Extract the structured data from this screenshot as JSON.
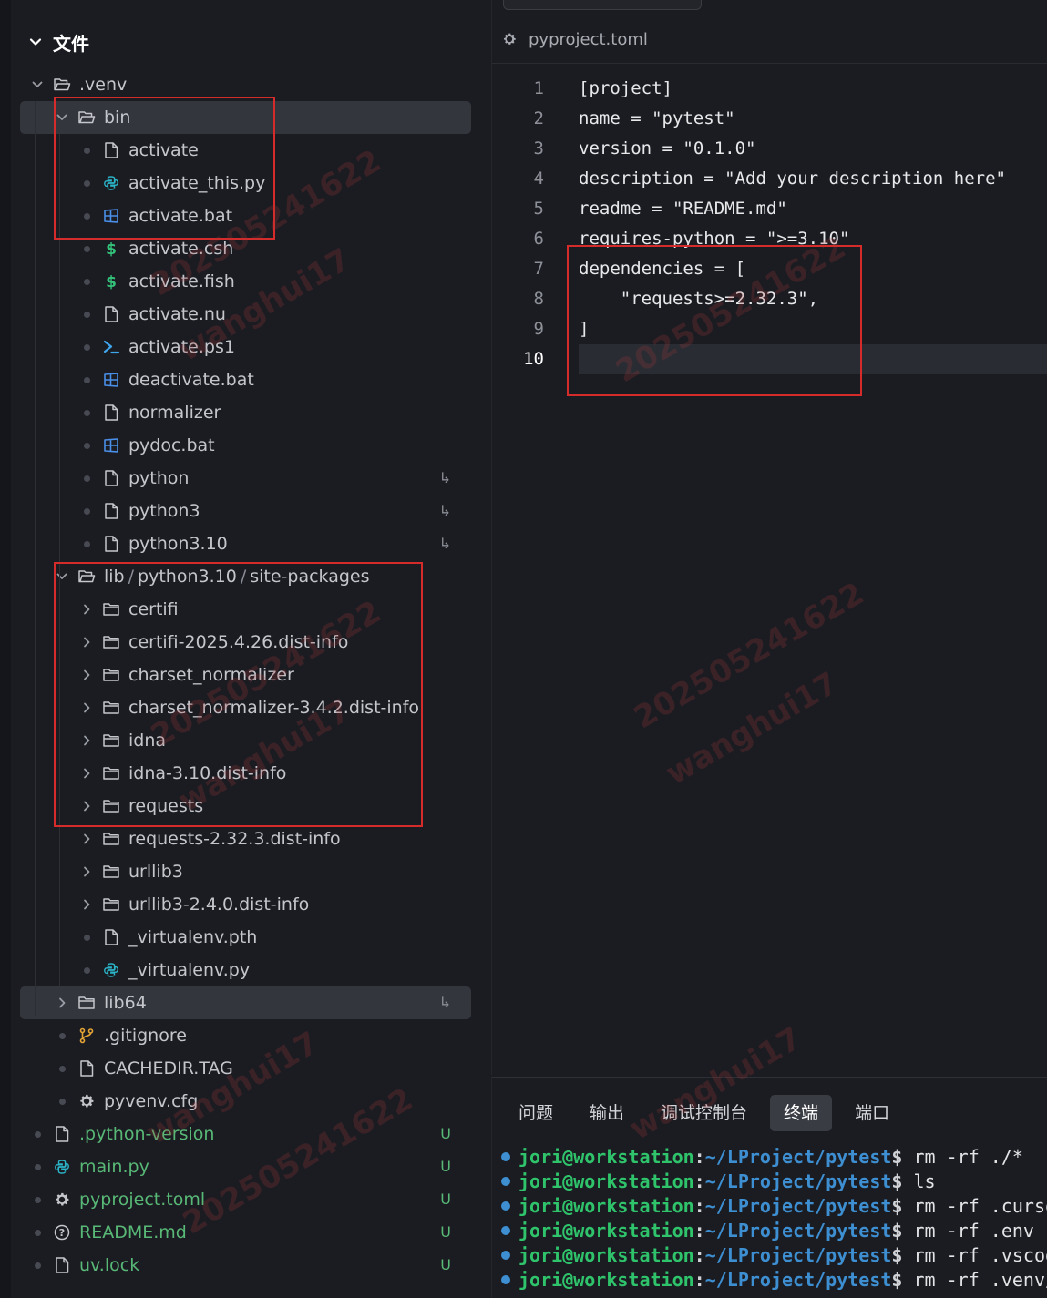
{
  "explorer": {
    "title": "文件",
    "rows": [
      {
        "id": "venv",
        "label": ".venv",
        "type": "folder-open",
        "lead": "chevron-down",
        "indent": 0
      },
      {
        "id": "bin",
        "label": "bin",
        "type": "folder-open",
        "lead": "chevron-down",
        "indent": 1,
        "selected": true
      },
      {
        "id": "activate",
        "label": "activate",
        "type": "file",
        "lead": "dot",
        "indent": 2
      },
      {
        "id": "activate_this",
        "label": "activate_this.py",
        "type": "python",
        "lead": "dot",
        "indent": 2
      },
      {
        "id": "activate_bat",
        "label": "activate.bat",
        "type": "windows",
        "lead": "dot",
        "indent": 2
      },
      {
        "id": "activate_csh",
        "label": "activate.csh",
        "type": "shell",
        "lead": "dot",
        "indent": 2
      },
      {
        "id": "activate_fish",
        "label": "activate.fish",
        "type": "shell",
        "lead": "dot",
        "indent": 2
      },
      {
        "id": "activate_nu",
        "label": "activate.nu",
        "type": "file",
        "lead": "dot",
        "indent": 2
      },
      {
        "id": "activate_ps1",
        "label": "activate.ps1",
        "type": "powershell",
        "lead": "dot",
        "indent": 2
      },
      {
        "id": "deactivate_bat",
        "label": "deactivate.bat",
        "type": "windows",
        "lead": "dot",
        "indent": 2
      },
      {
        "id": "normalizer",
        "label": "normalizer",
        "type": "file",
        "lead": "dot",
        "indent": 2
      },
      {
        "id": "pydoc_bat",
        "label": "pydoc.bat",
        "type": "windows",
        "lead": "dot",
        "indent": 2
      },
      {
        "id": "python",
        "label": "python",
        "type": "file",
        "lead": "dot",
        "indent": 2,
        "badge": "↳"
      },
      {
        "id": "python3",
        "label": "python3",
        "type": "file",
        "lead": "dot",
        "indent": 2,
        "badge": "↳"
      },
      {
        "id": "python310",
        "label": "python3.10",
        "type": "file",
        "lead": "dot",
        "indent": 2,
        "badge": "↳"
      },
      {
        "id": "site_packages",
        "label": "lib",
        "label2": "python3.10",
        "label3": "site-packages",
        "type": "folder-open",
        "lead": "chevron-down",
        "indent": 1
      },
      {
        "id": "certifi",
        "label": "certifi",
        "type": "folder",
        "lead": "chevron-right",
        "indent": 2
      },
      {
        "id": "certifi_dist",
        "label": "certifi-2025.4.26.dist-info",
        "type": "folder",
        "lead": "chevron-right",
        "indent": 2
      },
      {
        "id": "charset_normalizer",
        "label": "charset_normalizer",
        "type": "folder",
        "lead": "chevron-right",
        "indent": 2
      },
      {
        "id": "charset_normalizer_dist",
        "label": "charset_normalizer-3.4.2.dist-info",
        "type": "folder",
        "lead": "chevron-right",
        "indent": 2
      },
      {
        "id": "idna",
        "label": "idna",
        "type": "folder",
        "lead": "chevron-right",
        "indent": 2
      },
      {
        "id": "idna_dist",
        "label": "idna-3.10.dist-info",
        "type": "folder",
        "lead": "chevron-right",
        "indent": 2
      },
      {
        "id": "requests",
        "label": "requests",
        "type": "folder",
        "lead": "chevron-right",
        "indent": 2
      },
      {
        "id": "requests_dist",
        "label": "requests-2.32.3.dist-info",
        "type": "folder",
        "lead": "chevron-right",
        "indent": 2
      },
      {
        "id": "urllib3",
        "label": "urllib3",
        "type": "folder",
        "lead": "chevron-right",
        "indent": 2
      },
      {
        "id": "urllib3_dist",
        "label": "urllib3-2.4.0.dist-info",
        "type": "folder",
        "lead": "chevron-right",
        "indent": 2
      },
      {
        "id": "virtualenv_pth",
        "label": "_virtualenv.pth",
        "type": "file",
        "lead": "dot",
        "indent": 2
      },
      {
        "id": "virtualenv_py",
        "label": "_virtualenv.py",
        "type": "python",
        "lead": "dot",
        "indent": 2
      },
      {
        "id": "lib64",
        "label": "lib64",
        "type": "folder",
        "lead": "chevron-right",
        "indent": 1,
        "selected": true,
        "badge": "↳"
      },
      {
        "id": "gitignore",
        "label": ".gitignore",
        "type": "git",
        "lead": "dot",
        "indent": 1
      },
      {
        "id": "cachedir",
        "label": "CACHEDIR.TAG",
        "type": "file",
        "lead": "dot",
        "indent": 1
      },
      {
        "id": "pyvenv",
        "label": "pyvenv.cfg",
        "type": "gear",
        "lead": "dot",
        "indent": 1
      },
      {
        "id": "python_version",
        "label": ".python-version",
        "type": "file",
        "lead": "dot",
        "indent": 0,
        "badge": "U",
        "gitNew": true
      },
      {
        "id": "main_py",
        "label": "main.py",
        "type": "python",
        "lead": "dot",
        "indent": 0,
        "badge": "U",
        "gitNew": true
      },
      {
        "id": "pyproject",
        "label": "pyproject.toml",
        "type": "gear",
        "lead": "dot",
        "indent": 0,
        "badge": "U",
        "gitNew": true
      },
      {
        "id": "readme",
        "label": "README.md",
        "type": "info",
        "lead": "dot",
        "indent": 0,
        "badge": "U",
        "gitNew": true
      },
      {
        "id": "uvlock",
        "label": "uv.lock",
        "type": "file",
        "lead": "dot",
        "indent": 0,
        "badge": "U",
        "gitNew": true
      }
    ]
  },
  "editor": {
    "breadcrumb": "pyproject.toml",
    "lines": [
      {
        "n": "1",
        "text": "[project]"
      },
      {
        "n": "2",
        "text": "name = \"pytest\""
      },
      {
        "n": "3",
        "text": "version = \"0.1.0\""
      },
      {
        "n": "4",
        "text": "description = \"Add your description here\""
      },
      {
        "n": "5",
        "text": "readme = \"README.md\""
      },
      {
        "n": "6",
        "text": "requires-python = \">=3.10\""
      },
      {
        "n": "7",
        "text": "dependencies = ["
      },
      {
        "n": "8",
        "text": "    \"requests>=2.32.3\","
      },
      {
        "n": "9",
        "text": "]"
      },
      {
        "n": "10",
        "text": "",
        "current": true
      }
    ]
  },
  "panel": {
    "tabs": [
      {
        "label": "问题"
      },
      {
        "label": "输出"
      },
      {
        "label": "调试控制台"
      },
      {
        "label": "终端",
        "active": true
      },
      {
        "label": "端口"
      }
    ],
    "terminal": [
      {
        "user": "jori@workstation",
        "path": "~/LProject/pytest",
        "cmd": "rm -rf ./*"
      },
      {
        "user": "jori@workstation",
        "path": "~/LProject/pytest",
        "cmd": "ls"
      },
      {
        "user": "jori@workstation",
        "path": "~/LProject/pytest",
        "cmd": "rm -rf .curso"
      },
      {
        "user": "jori@workstation",
        "path": "~/LProject/pytest",
        "cmd": "rm -rf .env"
      },
      {
        "user": "jori@workstation",
        "path": "~/LProject/pytest",
        "cmd": "rm -rf .vscod"
      },
      {
        "user": "jori@workstation",
        "path": "~/LProject/pytest",
        "cmd": "rm -rf .venv/"
      }
    ]
  },
  "watermarks": [
    "20250524​1622",
    "wanghui17"
  ],
  "colors": {
    "background": "#1b1c22",
    "selection": "#34363e",
    "git_untracked": "#58b876",
    "annotation_red": "#d62b2b",
    "terminal_user": "#2fc46b",
    "terminal_path": "#3d8fd1"
  }
}
